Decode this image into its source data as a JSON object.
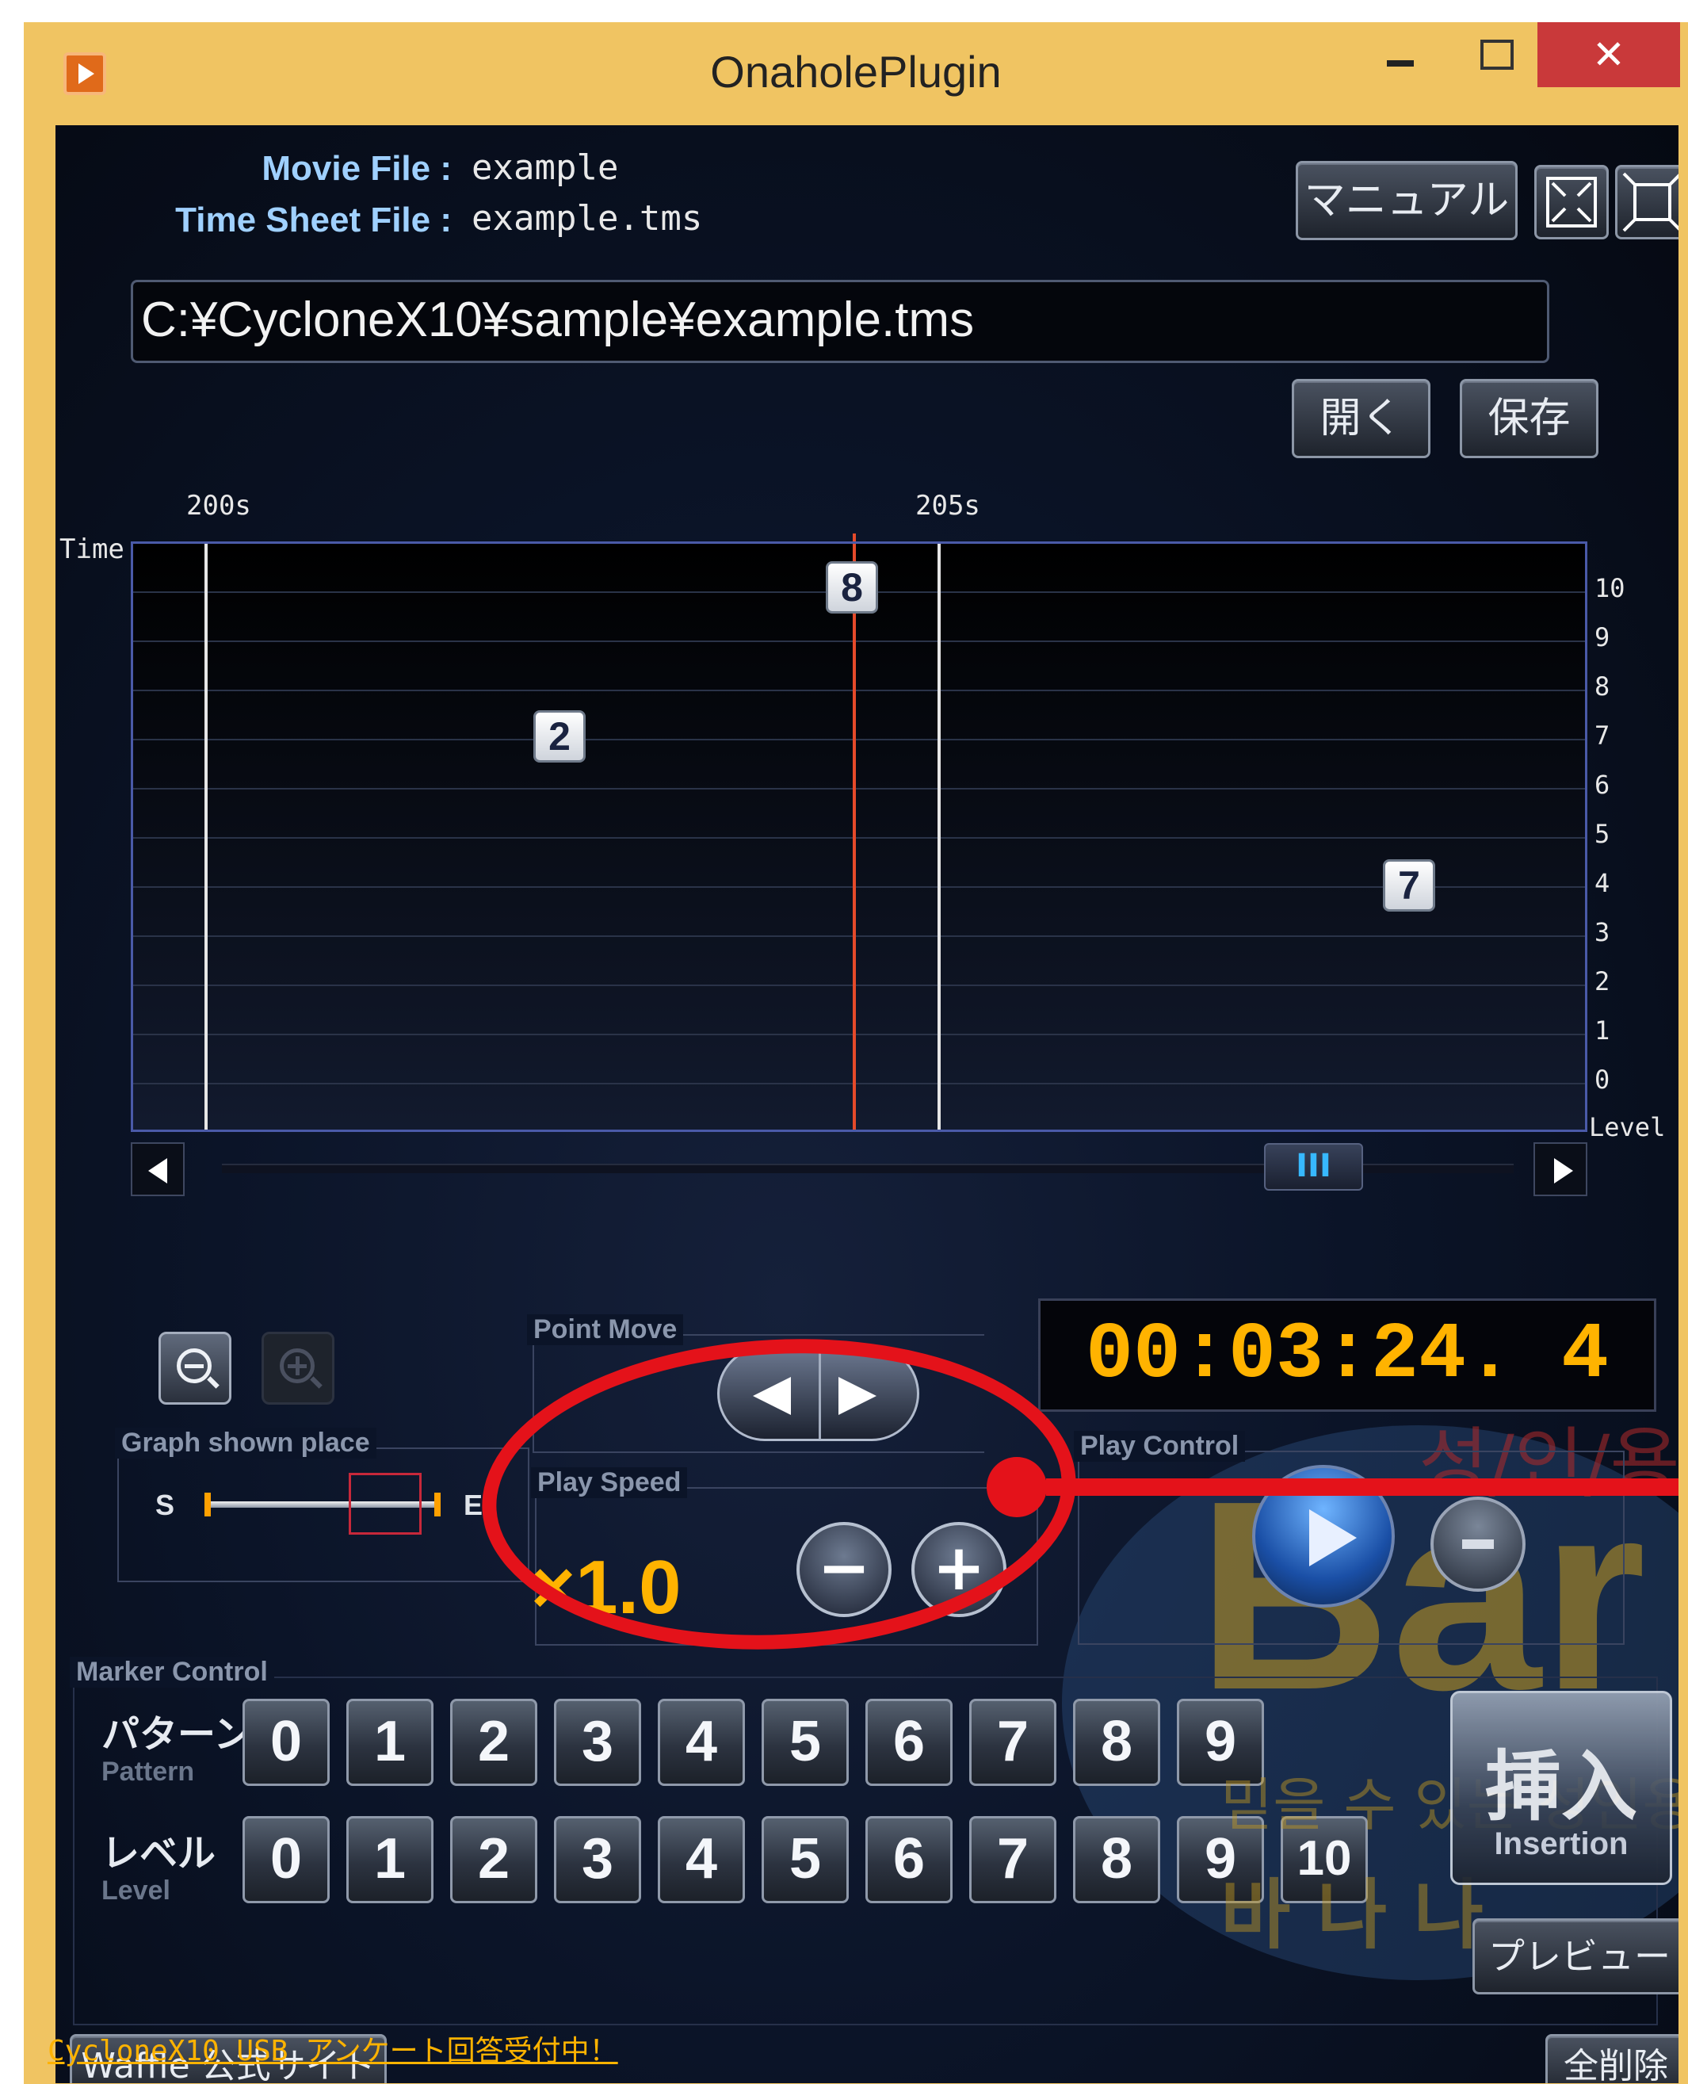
{
  "window": {
    "title": "OnaholePlugin",
    "close_glyph": "✕"
  },
  "file_info": {
    "movie_label": "Movie File :",
    "movie_value": "example",
    "timesheet_label": "Time Sheet File :",
    "timesheet_value": "example.tms",
    "path": "C:¥CycloneX10¥sample¥example.tms"
  },
  "toolbar": {
    "manual_label": "マニュアル",
    "open_label": "開く",
    "save_label": "保存",
    "fullscreen_icon": "expand-icon",
    "fit_icon": "fit-window-icon"
  },
  "graph": {
    "time_axis_label": "Time",
    "level_axis_label": "Level",
    "time_ticks": [
      "200s",
      "205s"
    ],
    "level_ticks": [
      "10",
      "9",
      "8",
      "7",
      "6",
      "5",
      "4",
      "3",
      "2",
      "1",
      "0"
    ],
    "markers": [
      "8",
      "2",
      "7"
    ],
    "scroll_thumb_glyph": "III",
    "playhead_color": "#e54a2a"
  },
  "point_move": {
    "title": "Point Move"
  },
  "time_display": {
    "value": "00:03:24. 4",
    "color": "#ffb300"
  },
  "graph_place": {
    "title": "Graph shown place",
    "start_label": "S",
    "end_label": "E"
  },
  "play_speed": {
    "title": "Play Speed",
    "value": "×1.0",
    "minus": "−",
    "plus": "+"
  },
  "play_control": {
    "title": "Play Control"
  },
  "marker_control": {
    "title": "Marker Control",
    "pattern_label_ja": "パターン",
    "pattern_label_en": "Pattern",
    "level_label_ja": "レベル",
    "level_label_en": "Level",
    "pattern_buttons": [
      "0",
      "1",
      "2",
      "3",
      "4",
      "5",
      "6",
      "7",
      "8",
      "9"
    ],
    "level_buttons": [
      "0",
      "1",
      "2",
      "3",
      "4",
      "5",
      "6",
      "7",
      "8",
      "9",
      "10"
    ],
    "insert_ja": "挿入",
    "insert_en": "Insertion",
    "preview_label": "プレビュー"
  },
  "bottom": {
    "official_site_label": "Waffle 公式サイト",
    "delete_all_label": "全削除",
    "footer_link": "CycloneX10 USB アンケート回答受付中！"
  },
  "watermark": {
    "line1": "성/인/용",
    "big": "Bar",
    "line2": "믿을 수 있는 성인용품",
    "line3": "바 나 나"
  },
  "annotation_color": "#e4121a"
}
